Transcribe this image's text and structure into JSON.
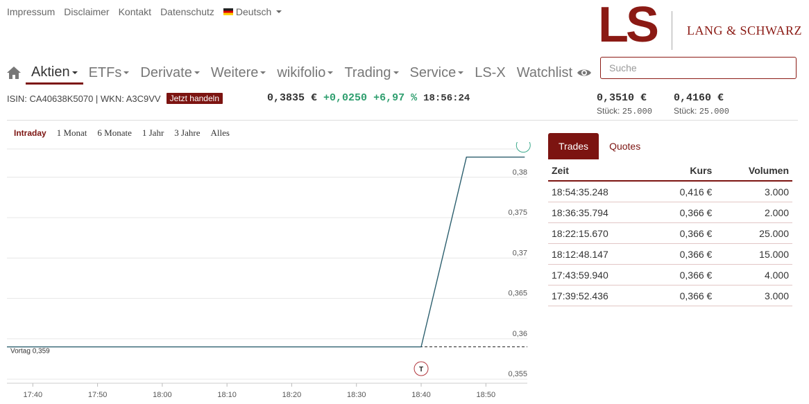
{
  "top_links": [
    "Impressum",
    "Disclaimer",
    "Kontakt",
    "Datenschutz"
  ],
  "language": "Deutsch",
  "logo": {
    "mark": "LS",
    "name": "LANG & SCHWARZ"
  },
  "nav": [
    {
      "label": "Aktien",
      "dropdown": true,
      "active": true
    },
    {
      "label": "ETFs",
      "dropdown": true
    },
    {
      "label": "Derivate",
      "dropdown": true
    },
    {
      "label": "Weitere",
      "dropdown": true
    },
    {
      "label": "wikifolio",
      "dropdown": true
    },
    {
      "label": "Trading",
      "dropdown": true
    },
    {
      "label": "Service",
      "dropdown": true
    },
    {
      "label": "LS-X",
      "dropdown": false
    },
    {
      "label": "Watchlist",
      "dropdown": false
    }
  ],
  "search": {
    "placeholder": "Suche"
  },
  "instrument": {
    "isin_line": "ISIN: CA40638K5070 | WKN: A3C9VV",
    "trade_button": "Jetzt handeln",
    "price": "0,3835 €",
    "change_abs": "+0,0250",
    "change_pct": "+6,97 %",
    "time": "18:56:24",
    "bid": {
      "price": "0,3510 €",
      "size_label": "Stück:",
      "size": "25.000"
    },
    "ask": {
      "price": "0,4160 €",
      "size_label": "Stück:",
      "size": "25.000"
    }
  },
  "ranges": [
    "Intraday",
    "1 Monat",
    "6 Monate",
    "1 Jahr",
    "3 Jahre",
    "Alles"
  ],
  "active_range": "Intraday",
  "colors": {
    "brand": "#7c1411",
    "positive": "#2e9e6e",
    "line": "#2c5f6e"
  },
  "chart_data": {
    "type": "line",
    "x_ticks": [
      "17:40",
      "17:50",
      "18:00",
      "18:10",
      "18:20",
      "18:30",
      "18:40",
      "18:50"
    ],
    "y_ticks": [
      "0,355",
      "0,36",
      "0,365",
      "0,37",
      "0,375",
      "0,38"
    ],
    "ylim": [
      0.3545,
      0.3835
    ],
    "xlim": [
      "17:36:00",
      "18:56:24"
    ],
    "series": [
      {
        "points": [
          [
            "17:36:00",
            0.359
          ],
          [
            "18:40:00",
            0.359
          ],
          [
            "18:47:00",
            0.3825
          ],
          [
            "18:56:00",
            0.3825
          ]
        ]
      }
    ],
    "previous_close": {
      "label": "Vortag 0,359",
      "value": 0.359
    },
    "markers": [
      {
        "label": "T",
        "time": "18:40:00",
        "value": 0.3563
      }
    ],
    "grid": true,
    "y_axis_side": "right"
  },
  "trade_tabs": [
    "Trades",
    "Quotes"
  ],
  "trades": {
    "columns": [
      "Zeit",
      "Kurs",
      "Volumen"
    ],
    "rows": [
      [
        "18:54:35.248",
        "0,416 €",
        "3.000"
      ],
      [
        "18:36:35.794",
        "0,366 €",
        "2.000"
      ],
      [
        "18:22:15.670",
        "0,366 €",
        "25.000"
      ],
      [
        "18:12:48.147",
        "0,366 €",
        "15.000"
      ],
      [
        "17:43:59.940",
        "0,366 €",
        "4.000"
      ],
      [
        "17:39:52.436",
        "0,366 €",
        "3.000"
      ]
    ]
  }
}
